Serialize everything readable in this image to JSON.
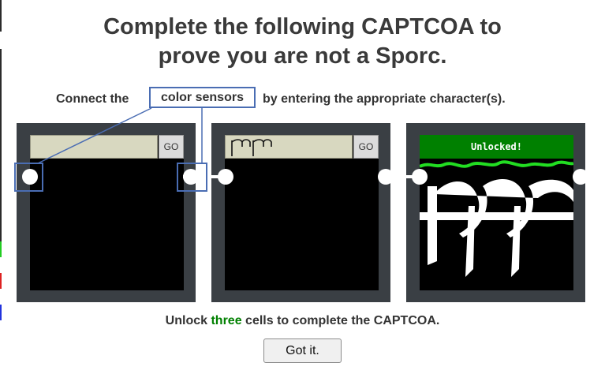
{
  "title": {
    "line1": "Complete the following CAPTCOA to",
    "line2": "prove you are not a Sporc."
  },
  "instruction": {
    "prefix": "Connect the",
    "highlight": "color sensors",
    "suffix": "by entering the appropriate character(s)."
  },
  "cells": [
    {
      "input_value": "",
      "go_label": "GO"
    },
    {
      "input_value": "ꟼꟼ",
      "go_label": "GO"
    },
    {
      "status": "Unlocked!"
    }
  ],
  "footer": {
    "prefix": "Unlock",
    "emphasis": "three",
    "suffix": "cells to complete the CAPTCOA."
  },
  "got_it_label": "Got it.",
  "colors": {
    "accent_blue": "#4a6db3",
    "unlocked_green": "#008000",
    "laser_green": "#22dd22",
    "cell_frame": "#3a3f44",
    "input_bg": "#d8d8c0"
  },
  "icons": [
    "left-sensor-icon",
    "right-sensor-icon",
    "glyph-icon",
    "laser-icon"
  ]
}
